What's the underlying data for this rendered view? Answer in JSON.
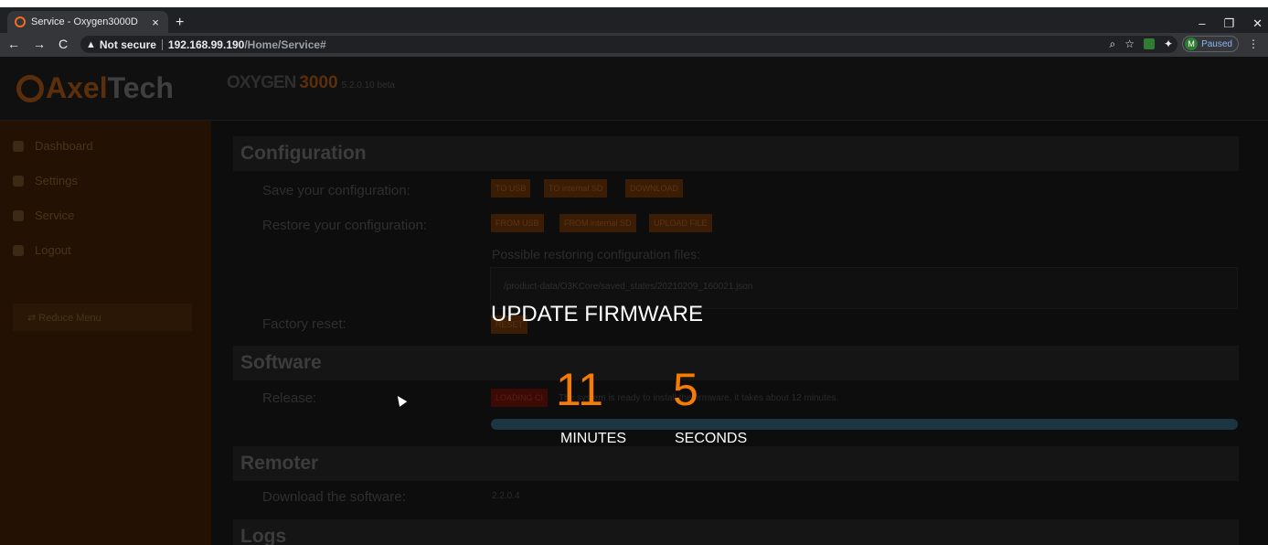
{
  "browser": {
    "tab_title": "Service - Oxygen3000D",
    "tab_close": "×",
    "new_tab": "+",
    "window_controls": [
      "–",
      "❐",
      "✕"
    ],
    "nav_icons": [
      "←",
      "→",
      "C"
    ],
    "security_warning": "Not secure",
    "host": "192.168.99.190",
    "path": "/Home/Service#",
    "profile_initial": "M",
    "profile_status": "Paused",
    "toolbar_icon_names": [
      "zoom-icon",
      "star-icon",
      "extension-icon",
      "puzzle-icon",
      "menu-icon"
    ]
  },
  "app": {
    "logo_axel": "Axel",
    "logo_tech": "Tech",
    "product_name": "OXYGEN",
    "product_number": "3000",
    "version": "5.2.0.10 beta",
    "brand_color": "#f57c00"
  },
  "sidebar": {
    "items": [
      {
        "label": "Dashboard",
        "icon": "dashboard-icon"
      },
      {
        "label": "Settings",
        "icon": "gears-icon"
      },
      {
        "label": "Service",
        "icon": "ambulance-icon"
      },
      {
        "label": "Logout",
        "icon": "logout-icon"
      }
    ],
    "reduce_label": "⇄  Reduce Menu"
  },
  "configuration": {
    "heading": "Configuration",
    "save_label": "Save your configuration:",
    "save_buttons": [
      "TO USB",
      "TO internal SD",
      "DOWNLOAD"
    ],
    "restore_label": "Restore your configuration:",
    "restore_buttons": [
      "FROM USB",
      "FROM internal SD",
      "UPLOAD FILE"
    ],
    "possible_files_label": "Possible restoring configuration files:",
    "file_path": "/product-data/O3KCore/saved_states/20210209_160021.json",
    "factory_label": "Factory reset:",
    "reset_button": "RESET"
  },
  "software": {
    "heading": "Software",
    "release_label": "Release:",
    "loading_button": "LOADING CI",
    "ready_text": "The system is ready to install the firmware, it takes about 12 minutes."
  },
  "remoter": {
    "heading": "Remoter",
    "download_label": "Download the software:",
    "version": "2.2.0.4"
  },
  "logs": {
    "heading": "Logs"
  },
  "overlay": {
    "title": "UPDATE FIRMWARE",
    "minutes": "11",
    "seconds": "5",
    "minutes_label": "MINUTES",
    "seconds_label": "SECONDS"
  }
}
